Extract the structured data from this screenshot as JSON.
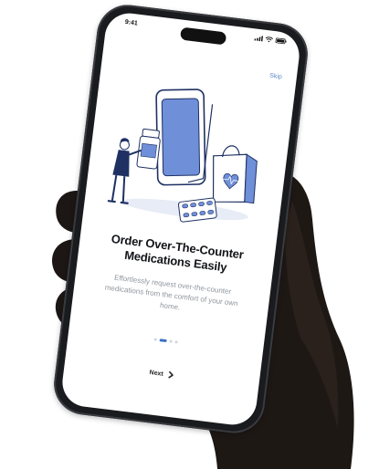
{
  "status_bar": {
    "time": "9:41",
    "icons": [
      "signal-icon",
      "wifi-icon",
      "battery-icon"
    ]
  },
  "onboarding": {
    "skip_label": "Skip",
    "title": "Order Over-The-Counter Medications Easily",
    "subtitle": "Effortlessly request over-the-counter medications from the comfort of your own home.",
    "next_label": "Next",
    "page_count": 4,
    "active_page": 2
  },
  "colors": {
    "accent": "#3b6fc4",
    "illustration_blue": "#6f8fd8",
    "illustration_navy": "#1f3163",
    "skip_text": "#5b8bc9"
  }
}
